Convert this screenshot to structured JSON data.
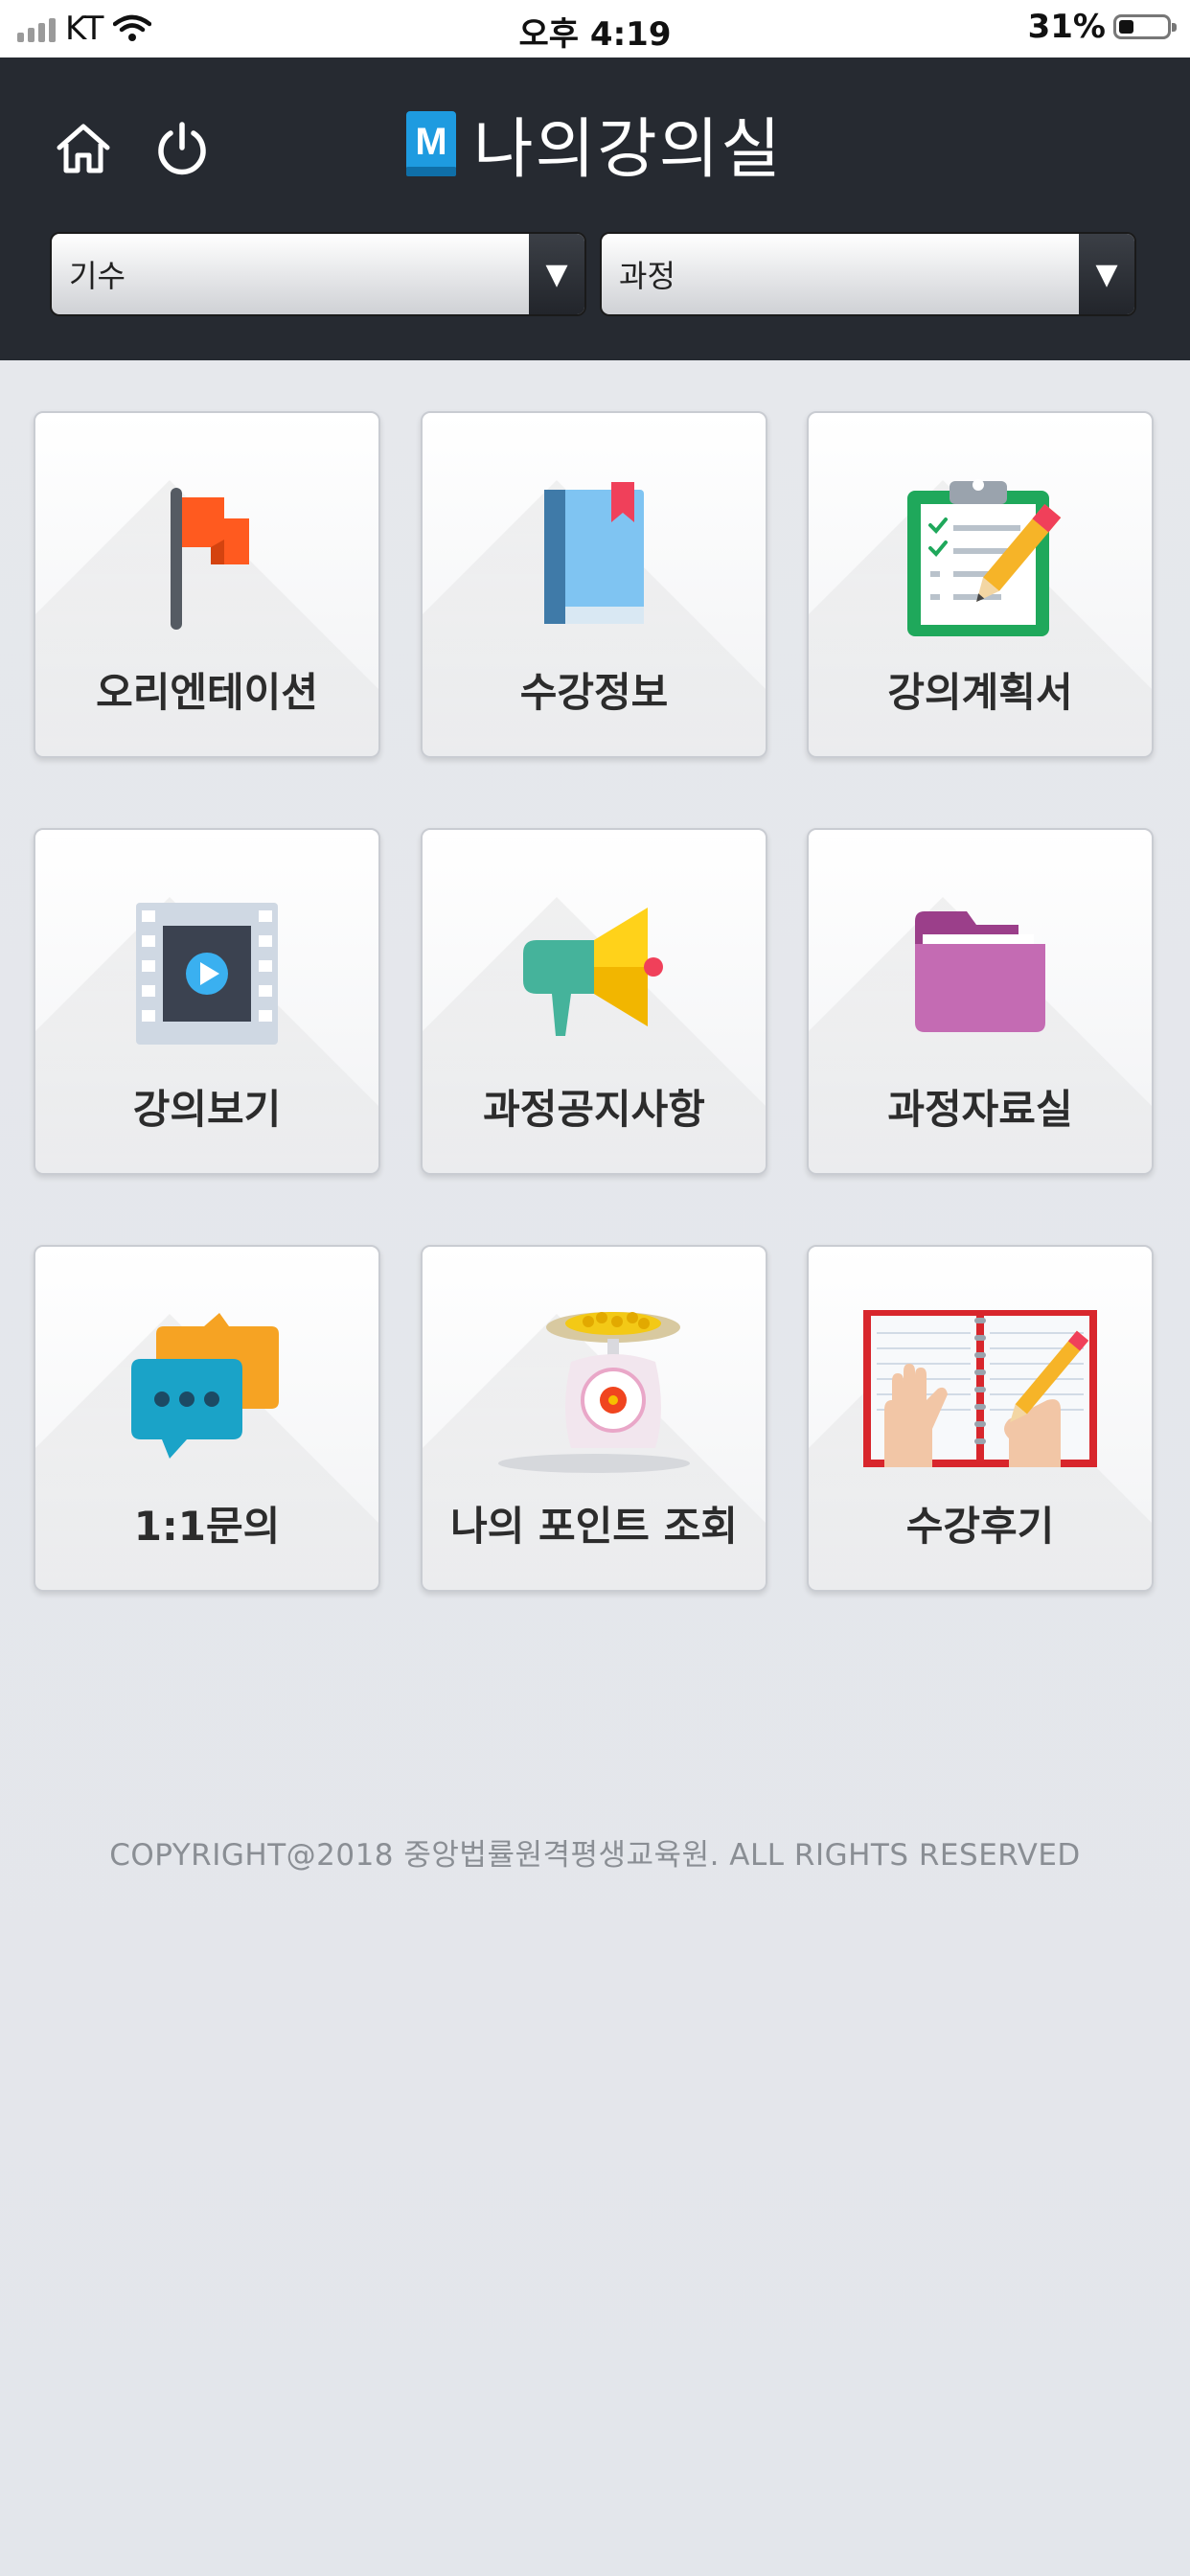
{
  "status_bar": {
    "carrier": "KT",
    "time": "오후 4:19",
    "battery_percent": "31%",
    "battery_level": 0.31
  },
  "header": {
    "title": "나의강의실",
    "logo_letter": "M",
    "filters": [
      {
        "value": "기수"
      },
      {
        "value": "과정"
      }
    ]
  },
  "menu": [
    {
      "label": "오리엔테이션",
      "icon": "orientation-flag-icon"
    },
    {
      "label": "수강정보",
      "icon": "course-info-book-icon"
    },
    {
      "label": "강의계획서",
      "icon": "syllabus-clipboard-icon"
    },
    {
      "label": "강의보기",
      "icon": "lecture-video-icon"
    },
    {
      "label": "과정공지사항",
      "icon": "notice-megaphone-icon"
    },
    {
      "label": "과정자료실",
      "icon": "materials-folder-icon"
    },
    {
      "label": "1:1문의",
      "icon": "inquiry-chat-icon"
    },
    {
      "label": "나의 포인트 조회",
      "icon": "points-scale-icon"
    },
    {
      "label": "수강후기",
      "icon": "review-notebook-icon"
    }
  ],
  "footer": {
    "copyright": "COPYRIGHT@2018 중앙법률원격평생교육원. ALL RIGHTS RESERVED"
  },
  "colors": {
    "header_bg": "#262a31",
    "page_bg": "#e4e7eb",
    "brand_blue": "#1e9be0"
  }
}
